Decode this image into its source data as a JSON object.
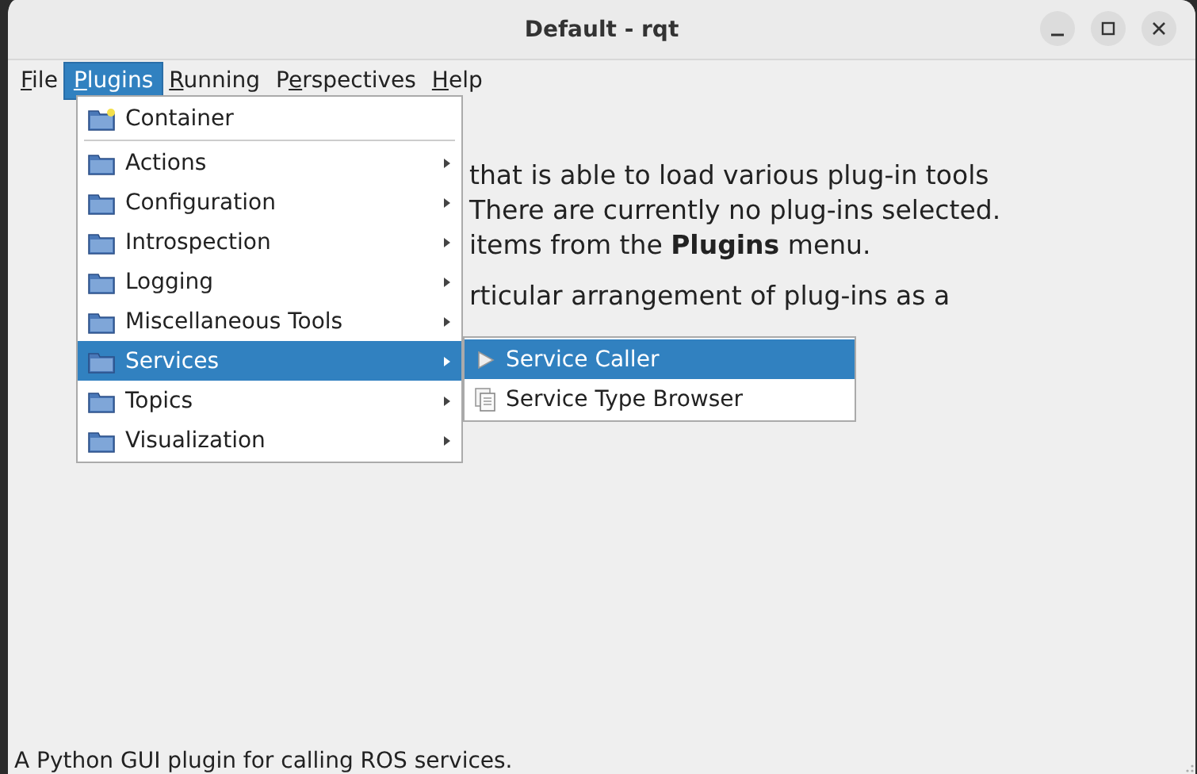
{
  "window": {
    "title": "Default - rqt"
  },
  "menubar": [
    {
      "key": "F",
      "post": "ile",
      "selected": false
    },
    {
      "key": "P",
      "post": "lugins",
      "selected": true
    },
    {
      "key": "R",
      "post": "unning",
      "selected": false
    },
    {
      "pre": "P",
      "key": "e",
      "post": "rspectives",
      "selected": false
    },
    {
      "key": "H",
      "post": "elp",
      "selected": false
    }
  ],
  "intro_lines": [
    "that is able to load various plug-in tools",
    "There are currently no plug-ins selected.",
    "items from the **Plugins** menu.",
    "rticular arrangement of plug-ins as a"
  ],
  "plugins_menu": [
    {
      "label": "Container",
      "kind": "container",
      "submenu": false,
      "selected": false,
      "separator_after": true
    },
    {
      "label": "Actions",
      "kind": "folder",
      "submenu": true,
      "selected": false
    },
    {
      "label": "Configuration",
      "kind": "folder",
      "submenu": true,
      "selected": false
    },
    {
      "label": "Introspection",
      "kind": "folder",
      "submenu": true,
      "selected": false
    },
    {
      "label": "Logging",
      "kind": "folder",
      "submenu": true,
      "selected": false
    },
    {
      "label": "Miscellaneous Tools",
      "kind": "folder",
      "submenu": true,
      "selected": false
    },
    {
      "label": "Services",
      "kind": "folder",
      "submenu": true,
      "selected": true
    },
    {
      "label": "Topics",
      "kind": "folder",
      "submenu": true,
      "selected": false
    },
    {
      "label": "Visualization",
      "kind": "folder",
      "submenu": true,
      "selected": false
    }
  ],
  "services_submenu": [
    {
      "label": "Service Caller",
      "kind": "plugin",
      "selected": true
    },
    {
      "label": "Service Type Browser",
      "kind": "document",
      "selected": false
    }
  ],
  "status_bar": "A Python GUI plugin for calling ROS services."
}
